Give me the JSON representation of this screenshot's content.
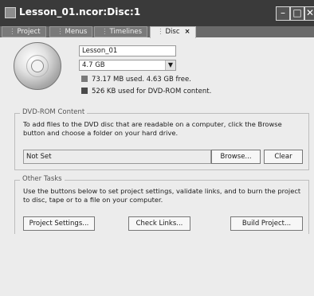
{
  "window": {
    "title": "Lesson_01.ncor:Disc:1",
    "controls": {
      "minimize": "–",
      "maximize": "□",
      "close": "✕"
    }
  },
  "tabs": [
    {
      "label": "Project",
      "active": false
    },
    {
      "label": "Menus",
      "active": false
    },
    {
      "label": "Timelines",
      "active": false
    },
    {
      "label": "Disc",
      "active": true,
      "close": "×"
    }
  ],
  "disc": {
    "name": "Lesson_01",
    "size": "4.7 GB",
    "used_text": "73.17 MB used.",
    "free_text": "4.63 GB free.",
    "dvdrom_text": "526 KB used for DVD-ROM content.",
    "used_color": "#7a7a7a",
    "dvdrom_color": "#4a4a4a"
  },
  "dvdrom": {
    "title": "DVD-ROM Content",
    "description": "To add files to the DVD disc that are readable on a computer, click the Browse button and choose a folder on your hard drive.",
    "folder_value": "Not Set",
    "browse_label": "Browse...",
    "clear_label": "Clear"
  },
  "other": {
    "title": "Other Tasks",
    "description": "Use the buttons below to set project settings, validate links, and to burn the project to disc, tape or to a file on your computer.",
    "project_settings_label": "Project Settings...",
    "check_links_label": "Check Links...",
    "build_project_label": "Build Project..."
  }
}
